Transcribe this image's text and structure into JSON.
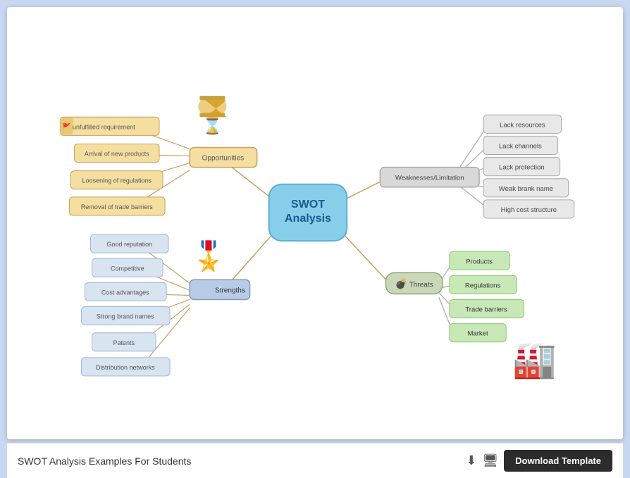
{
  "footer": {
    "title": "SWOT Analysis Examples For Students",
    "download_label": "Download Template"
  },
  "diagram": {
    "center": "SWOT\nAnalysis",
    "opportunities": {
      "label": "Opportunities",
      "items": [
        "An unfulfilled requirement",
        "Arrival of new products",
        "Loosening of regulations",
        "Removal of trade barriers"
      ]
    },
    "strengths": {
      "label": "Strengths",
      "items": [
        "Good reputation",
        "Competitive",
        "Cost advantages",
        "Strong brand names",
        "Patents",
        "Distribution networks"
      ]
    },
    "weaknesses": {
      "label": "Weaknesses/Limitation",
      "items": [
        "Lack resources",
        "Lack channels",
        "Lack protection",
        "Weak brank name",
        "High cost structure"
      ]
    },
    "threats": {
      "label": "Threats",
      "items": [
        "Products",
        "Regulations",
        "Trade barriers",
        "Market"
      ]
    }
  }
}
